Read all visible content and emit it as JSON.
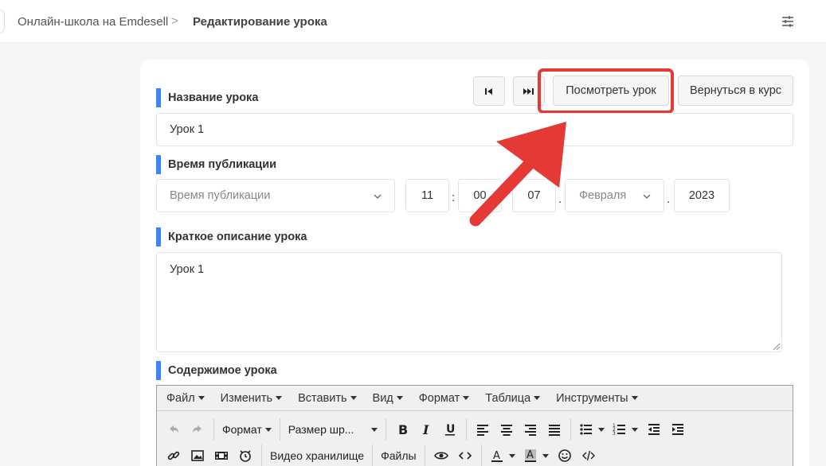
{
  "breadcrumb": {
    "home": "Онлайн-школа на Emdesell",
    "separator": ">",
    "current": "Редактирование урока"
  },
  "buttons": {
    "view_lesson": "Посмотреть урок",
    "back_to_course": "Вернуться в курс"
  },
  "lesson_name": {
    "label": "Название урока",
    "value": "Урок 1"
  },
  "publish_time": {
    "label": "Время публикации",
    "mode_placeholder": "Время публикации",
    "hour": "11",
    "minute": "00",
    "day": "07",
    "month": "Февраля",
    "year": "2023"
  },
  "short_description": {
    "label": "Краткое описание урока",
    "value": "Урок 1"
  },
  "content": {
    "label": "Содержимое урока",
    "menu": [
      "Файл",
      "Изменить",
      "Вставить",
      "Вид",
      "Формат",
      "Таблица",
      "Инструменты"
    ],
    "format_dropdown": "Формат",
    "font_size_dropdown": "Размер шр...",
    "video_storage": "Видео хранилище",
    "files": "Файлы"
  },
  "colors": {
    "accent": "#3b86f5",
    "highlight": "#e53935"
  }
}
